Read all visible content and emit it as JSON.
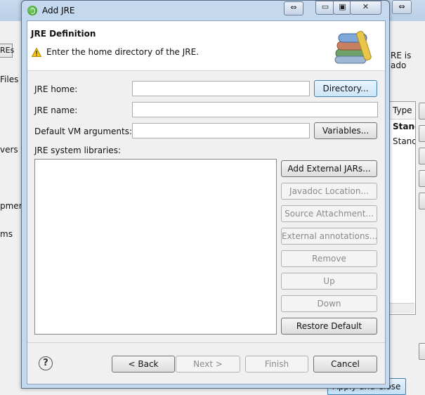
{
  "background": {
    "left_items": [
      "REs",
      "Files",
      "vers",
      "pmer",
      "ms"
    ],
    "right_text": "RE is ado",
    "table_header": "Type",
    "table_rows": [
      "Stand",
      "Stand"
    ],
    "apply_button": "Apply and Close"
  },
  "dialog": {
    "title": "Add JRE",
    "titlebar_buttons": {
      "expand": "⇔",
      "minimize": "▭",
      "maximize": "▣",
      "close": "✕"
    },
    "header": {
      "title": "JRE Definition",
      "message": "Enter the home directory of the JRE."
    },
    "fields": {
      "jre_home_label": "JRE home:",
      "jre_home_value": "",
      "jre_name_label": "JRE name:",
      "jre_name_value": "",
      "vm_args_label": "Default VM arguments:",
      "vm_args_value": "",
      "libs_label": "JRE system libraries:"
    },
    "buttons": {
      "directory": "Directory...",
      "variables": "Variables...",
      "add_external_jars": "Add External JARs...",
      "javadoc_location": "Javadoc Location...",
      "source_attachment": "Source Attachment...",
      "external_annotations": "External annotations...",
      "remove": "Remove",
      "up": "Up",
      "down": "Down",
      "restore_default": "Restore Default"
    },
    "footer": {
      "help": "?",
      "back": "< Back",
      "next": "Next >",
      "finish": "Finish",
      "cancel": "Cancel"
    }
  }
}
